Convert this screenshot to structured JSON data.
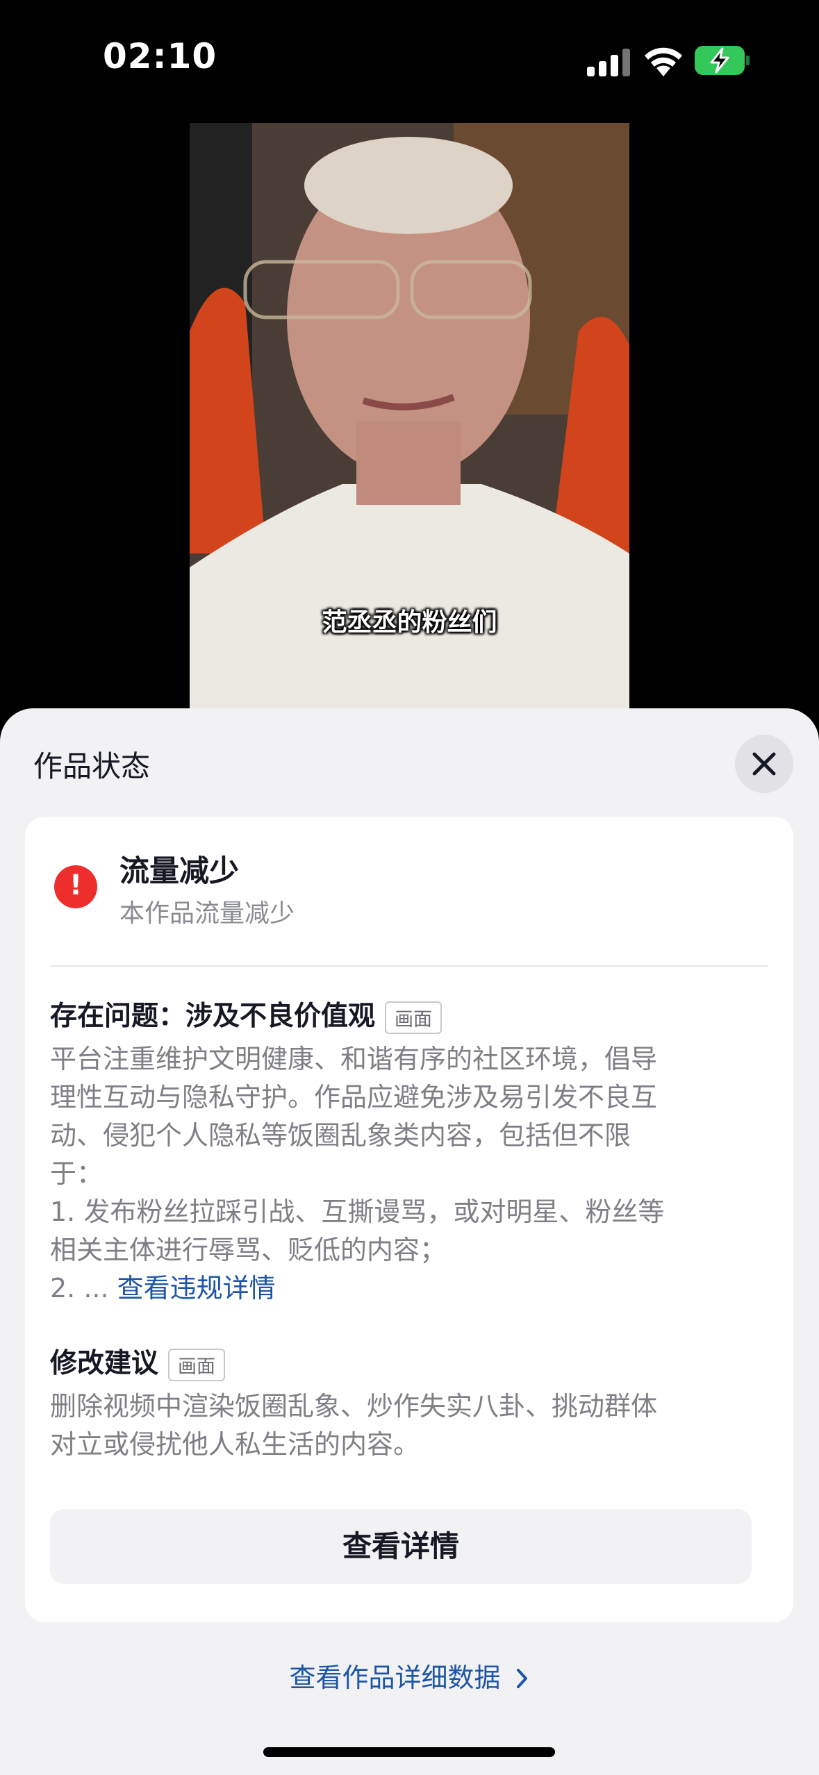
{
  "status_bar": {
    "time": "02:10",
    "icons": [
      "cellular-signal-icon",
      "wifi-icon",
      "battery-charging-icon"
    ],
    "battery_color": "#34c759"
  },
  "video": {
    "caption": "范丞丞的粉丝们"
  },
  "sheet": {
    "title": "作品状态",
    "close_icon": "close-icon",
    "status": {
      "icon": "exclamation-icon",
      "icon_symbol": "!",
      "icon_color": "#ee2d2d",
      "title": "流量减少",
      "subtitle": "本作品流量减少"
    },
    "issue": {
      "heading": "存在问题：涉及不良价值观",
      "tag": "画面",
      "lines": [
        "平台注重维护文明健康、和谐有序的社区环境，倡导",
        "理性互动与隐私守护。作品应避免涉及易引发不良互",
        "动、侵犯个人隐私等饭圈乱象类内容，包括但不限",
        "于：",
        "1. 发布粉丝拉踩引战、互撕谩骂，或对明星、粉丝等",
        "相关主体进行辱骂、贬低的内容；"
      ],
      "last_line_prefix": "2. ... ",
      "view_violation_link": "查看违规详情"
    },
    "suggestion": {
      "heading": "修改建议",
      "tag": "画面",
      "lines": [
        "删除视频中渲染饭圈乱象、炒作失实八卦、挑动群体",
        "对立或侵扰他人私生活的内容。"
      ]
    },
    "details_button": "查看详情",
    "data_link": "查看作品详细数据",
    "data_link_icon": "chevron-right-icon",
    "link_color": "#1d56a6"
  }
}
